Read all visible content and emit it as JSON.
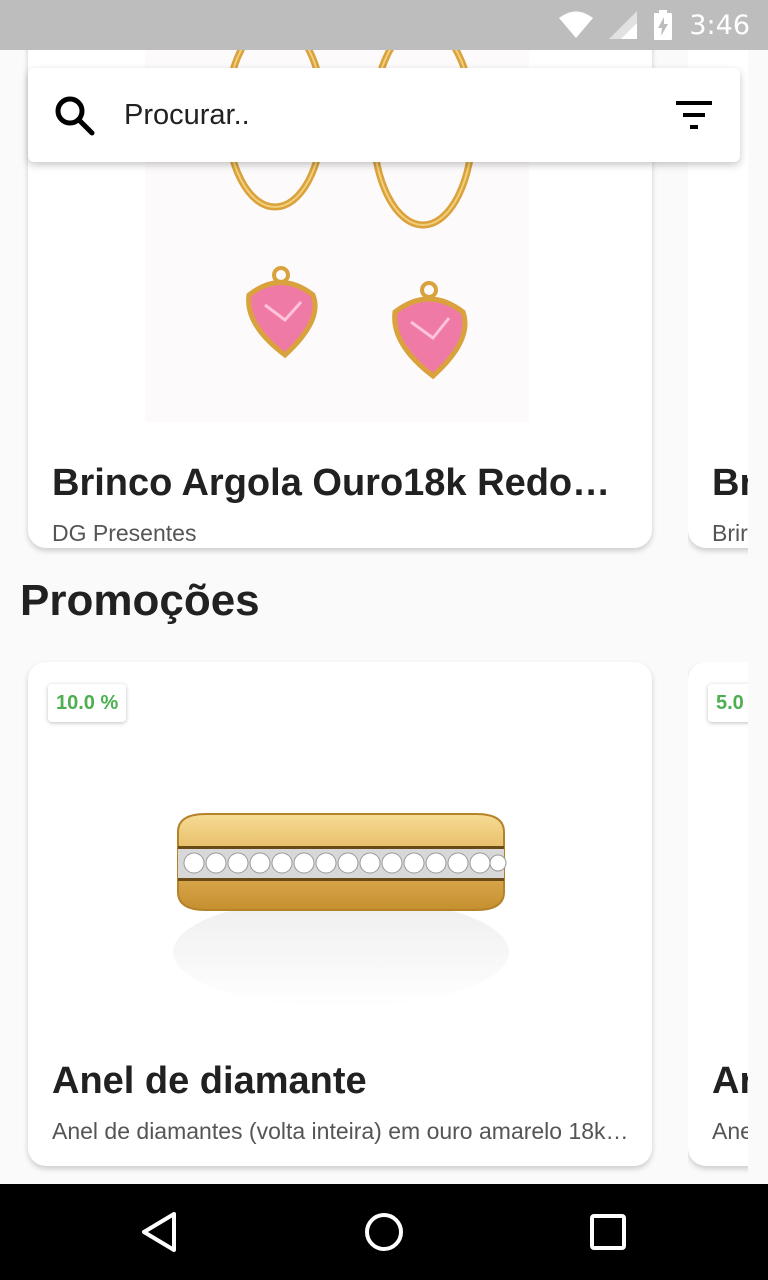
{
  "status_bar": {
    "time": "3:46",
    "icons": [
      "wifi-icon",
      "signal-icon",
      "battery-charging-icon"
    ]
  },
  "search": {
    "placeholder": "Procurar..",
    "icon": "search-icon",
    "filter_icon": "filter-icon"
  },
  "featured_cards": [
    {
      "title": "Brinco Argola Ouro18k Redon…",
      "subtitle": "DG Presentes",
      "image": "gold-hoop-earrings-pink-heart"
    },
    {
      "title": "Br",
      "subtitle": "Brir"
    }
  ],
  "promotions": {
    "section_title": "Promoções",
    "cards": [
      {
        "badge": "10.0 %",
        "title": "Anel de diamante",
        "subtitle": "Anel de diamantes (volta inteira) em ouro amarelo 18k…",
        "image": "gold-diamond-band-ring"
      },
      {
        "badge": "5.0",
        "title": "Ar",
        "subtitle": "Ane"
      }
    ]
  },
  "nav_bar": {
    "icons": [
      "back-icon",
      "home-icon",
      "recents-icon"
    ]
  },
  "colors": {
    "status_bar": "#bdbdbd",
    "badge_text": "#4caf50",
    "background": "#fafafa"
  }
}
